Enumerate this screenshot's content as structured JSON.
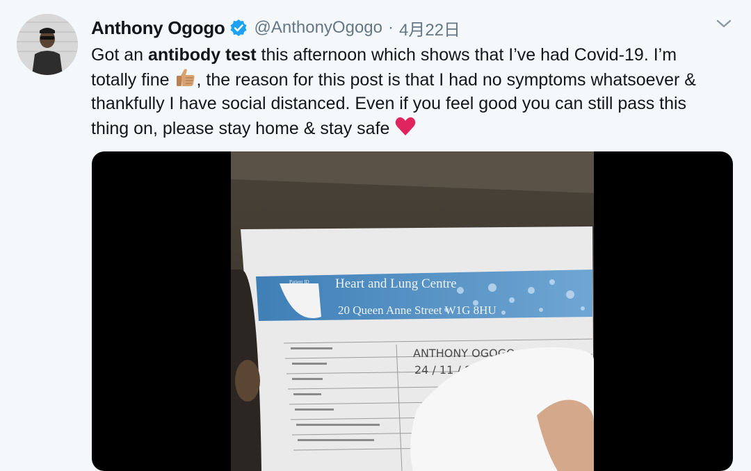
{
  "author": {
    "name": "Anthony Ogogo",
    "handle": "@AnthonyOgogo",
    "separator": "·",
    "date": "4月22日"
  },
  "tweet": {
    "line1_a": "Got an ",
    "line1_bold": "antibody test",
    "line1_b": " this afternoon which shows that I’ve had Covid-19. I’m",
    "line2_a": "totally fine ",
    "line2_b": ", the reason for this post is that I had no symptoms whatsoever &",
    "line3": "thankfully I have social distanced. Even if you feel good you can still pass this",
    "line4": "thing on, please stay home & stay safe "
  },
  "media": {
    "clinic_name": "Heart and Lung Centre",
    "clinic_address": "20 Queen Anne Street W1G 8HU",
    "form_tag": "Patient ID",
    "handwritten_name": "ANTHONY OGOGO",
    "handwritten_dob": "24 / 11 / 8"
  },
  "icons": {
    "verified": "verified-badge-icon",
    "caret": "chevron-down-icon",
    "thumbs_up": "thumbs-up-emoji-icon",
    "heart": "red-heart-emoji-icon"
  },
  "colors": {
    "background": "#f5f8fa",
    "text": "#14171a",
    "secondary_text": "#657786",
    "verified_blue": "#1da1f2",
    "heart_red": "#e0245e"
  }
}
